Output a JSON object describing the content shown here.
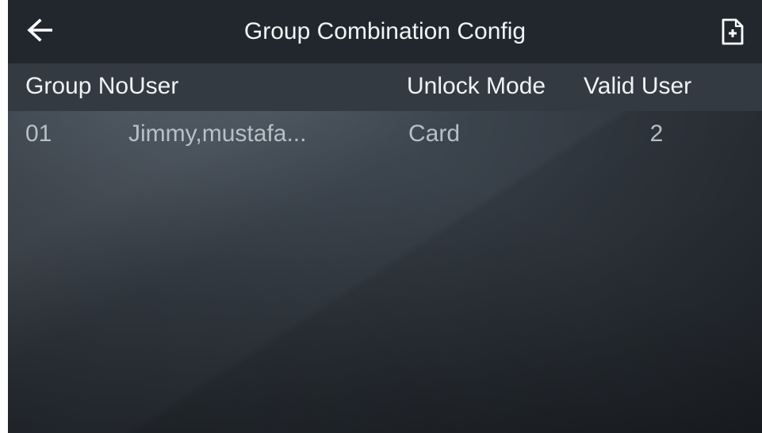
{
  "header": {
    "title": "Group Combination Config",
    "back_icon": "back-arrow-icon",
    "add_icon": "add-file-icon"
  },
  "table": {
    "columns": [
      "Group No",
      "User",
      "Unlock Mode",
      "Valid User"
    ],
    "rows": [
      {
        "group_no": "01",
        "user": "Jimmy,mustafa...",
        "unlock_mode": "Card",
        "valid_user": "2"
      }
    ]
  },
  "colors": {
    "titlebar": "#22272d",
    "header_row": "#333a42",
    "text_primary": "#f0f2f4",
    "text_secondary": "#b7bfc7"
  }
}
